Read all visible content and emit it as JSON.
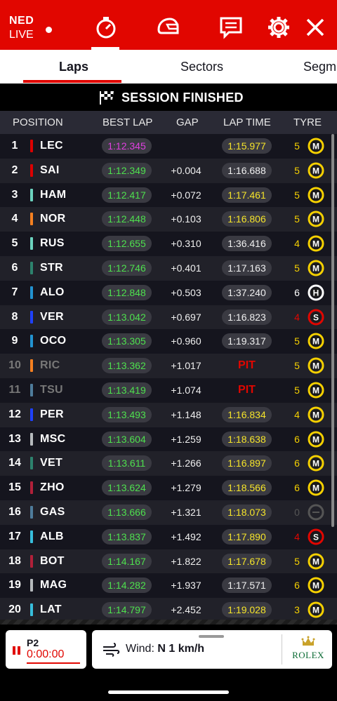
{
  "header": {
    "country_code": "NED",
    "live_label": "LIVE"
  },
  "tabs": [
    {
      "label": "Laps",
      "active": true
    },
    {
      "label": "Sectors",
      "active": false
    },
    {
      "label": "Segm",
      "active": false
    }
  ],
  "banner": {
    "text": "SESSION FINISHED",
    "icon": "checkered-flag-icon"
  },
  "table": {
    "headers": {
      "position": "POSITION",
      "best_lap": "BEST LAP",
      "gap": "GAP",
      "lap_time": "LAP TIME",
      "tyre": "TYRE"
    },
    "rows": [
      {
        "pos": "1",
        "driver": "LEC",
        "team_color": "#dc0000",
        "best": "1:12.345",
        "best_purple": true,
        "gap": "",
        "lap": "1:15.977",
        "lap_yellow": true,
        "tyre_laps": "5",
        "tyre": "M",
        "tyre_color": "#f5d000",
        "laps_color": "#f5d000"
      },
      {
        "pos": "2",
        "driver": "SAI",
        "team_color": "#dc0000",
        "best": "1:12.349",
        "gap": "+0.004",
        "lap": "1:16.688",
        "tyre_laps": "5",
        "tyre": "M",
        "tyre_color": "#f5d000",
        "laps_color": "#f5d000"
      },
      {
        "pos": "3",
        "driver": "HAM",
        "team_color": "#6cd3bf",
        "best": "1:12.417",
        "gap": "+0.072",
        "lap": "1:17.461",
        "lap_yellow": true,
        "tyre_laps": "5",
        "tyre": "M",
        "tyre_color": "#f5d000",
        "laps_color": "#f5d000"
      },
      {
        "pos": "4",
        "driver": "NOR",
        "team_color": "#f58020",
        "best": "1:12.448",
        "gap": "+0.103",
        "lap": "1:16.806",
        "lap_yellow": true,
        "tyre_laps": "5",
        "tyre": "M",
        "tyre_color": "#f5d000",
        "laps_color": "#f5d000"
      },
      {
        "pos": "5",
        "driver": "RUS",
        "team_color": "#6cd3bf",
        "best": "1:12.655",
        "gap": "+0.310",
        "lap": "1:36.416",
        "tyre_laps": "4",
        "tyre": "M",
        "tyre_color": "#f5d000",
        "laps_color": "#f5d000"
      },
      {
        "pos": "6",
        "driver": "STR",
        "team_color": "#2d826d",
        "best": "1:12.746",
        "gap": "+0.401",
        "lap": "1:17.163",
        "tyre_laps": "5",
        "tyre": "M",
        "tyre_color": "#f5d000",
        "laps_color": "#f5d000"
      },
      {
        "pos": "7",
        "driver": "ALO",
        "team_color": "#2293d1",
        "best": "1:12.848",
        "gap": "+0.503",
        "lap": "1:37.240",
        "tyre_laps": "6",
        "tyre": "H",
        "tyre_color": "#ffffff",
        "laps_color": "#ffffff"
      },
      {
        "pos": "8",
        "driver": "VER",
        "team_color": "#1e41ff",
        "best": "1:13.042",
        "gap": "+0.697",
        "lap": "1:16.823",
        "tyre_laps": "4",
        "tyre": "S",
        "tyre_color": "#e10600",
        "laps_color": "#e10600"
      },
      {
        "pos": "9",
        "driver": "OCO",
        "team_color": "#2293d1",
        "best": "1:13.305",
        "gap": "+0.960",
        "lap": "1:19.317",
        "tyre_laps": "5",
        "tyre": "M",
        "tyre_color": "#f5d000",
        "laps_color": "#f5d000"
      },
      {
        "pos": "10",
        "driver": "RIC",
        "team_color": "#f58020",
        "best": "1:13.362",
        "gap": "+1.017",
        "pit": "PIT",
        "dim": true,
        "tyre_laps": "5",
        "tyre": "M",
        "tyre_color": "#f5d000",
        "laps_color": "#f5d000"
      },
      {
        "pos": "11",
        "driver": "TSU",
        "team_color": "#4e7c9b",
        "best": "1:13.419",
        "gap": "+1.074",
        "pit": "PIT",
        "dim": true,
        "tyre_laps": "5",
        "tyre": "M",
        "tyre_color": "#f5d000",
        "laps_color": "#f5d000"
      },
      {
        "pos": "12",
        "driver": "PER",
        "team_color": "#1e41ff",
        "best": "1:13.493",
        "gap": "+1.148",
        "lap": "1:16.834",
        "lap_yellow": true,
        "tyre_laps": "4",
        "tyre": "M",
        "tyre_color": "#f5d000",
        "laps_color": "#f5d000"
      },
      {
        "pos": "13",
        "driver": "MSC",
        "team_color": "#b6babd",
        "best": "1:13.604",
        "gap": "+1.259",
        "lap": "1:18.638",
        "lap_yellow": true,
        "tyre_laps": "6",
        "tyre": "M",
        "tyre_color": "#f5d000",
        "laps_color": "#f5d000"
      },
      {
        "pos": "14",
        "driver": "VET",
        "team_color": "#2d826d",
        "best": "1:13.611",
        "gap": "+1.266",
        "lap": "1:16.897",
        "lap_yellow": true,
        "tyre_laps": "6",
        "tyre": "M",
        "tyre_color": "#f5d000",
        "laps_color": "#f5d000"
      },
      {
        "pos": "15",
        "driver": "ZHO",
        "team_color": "#b12039",
        "best": "1:13.624",
        "gap": "+1.279",
        "lap": "1:18.566",
        "lap_yellow": true,
        "tyre_laps": "6",
        "tyre": "M",
        "tyre_color": "#f5d000",
        "laps_color": "#f5d000"
      },
      {
        "pos": "16",
        "driver": "GAS",
        "team_color": "#4e7c9b",
        "best": "1:13.666",
        "gap": "+1.321",
        "lap": "1:18.073",
        "lap_yellow": true,
        "tyre_laps": "0",
        "tyre": "",
        "tyre_color": "#555555",
        "laps_color": "#555555"
      },
      {
        "pos": "17",
        "driver": "ALB",
        "team_color": "#37bedd",
        "best": "1:13.837",
        "gap": "+1.492",
        "lap": "1:17.890",
        "lap_yellow": true,
        "tyre_laps": "4",
        "tyre": "S",
        "tyre_color": "#e10600",
        "laps_color": "#e10600"
      },
      {
        "pos": "18",
        "driver": "BOT",
        "team_color": "#b12039",
        "best": "1:14.167",
        "gap": "+1.822",
        "lap": "1:17.678",
        "lap_yellow": true,
        "tyre_laps": "5",
        "tyre": "M",
        "tyre_color": "#f5d000",
        "laps_color": "#f5d000"
      },
      {
        "pos": "19",
        "driver": "MAG",
        "team_color": "#b6babd",
        "best": "1:14.282",
        "gap": "+1.937",
        "lap": "1:17.571",
        "tyre_laps": "6",
        "tyre": "M",
        "tyre_color": "#f5d000",
        "laps_color": "#f5d000"
      },
      {
        "pos": "20",
        "driver": "LAT",
        "team_color": "#37bedd",
        "best": "1:14.797",
        "gap": "+2.452",
        "lap": "1:19.028",
        "lap_yellow": true,
        "tyre_laps": "3",
        "tyre": "M",
        "tyre_color": "#f5d000",
        "laps_color": "#f5d000"
      }
    ]
  },
  "footer": {
    "session_label": "P2",
    "timer": "0:00:00",
    "wind_label": "Wind:",
    "wind_value": "N 1 km/h",
    "sponsor": "ROLEX"
  },
  "colors": {
    "brand_red": "#e10600",
    "purple": "#e040e0",
    "green": "#4ee04e",
    "yellow": "#f5e42a"
  }
}
